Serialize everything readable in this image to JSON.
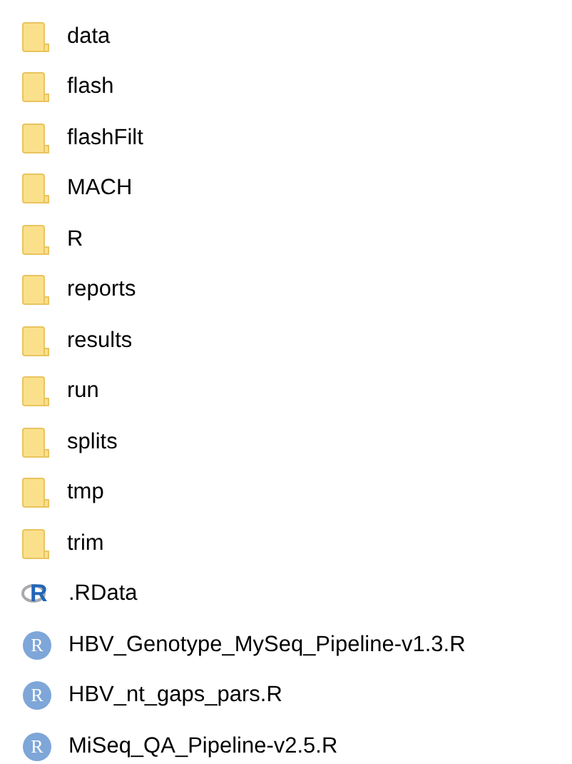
{
  "items": [
    {
      "kind": "folder",
      "name": "data"
    },
    {
      "kind": "folder",
      "name": "flash"
    },
    {
      "kind": "folder",
      "name": "flashFilt"
    },
    {
      "kind": "folder",
      "name": "MACH"
    },
    {
      "kind": "folder",
      "name": "R"
    },
    {
      "kind": "folder",
      "name": "reports"
    },
    {
      "kind": "folder",
      "name": "results"
    },
    {
      "kind": "folder",
      "name": "run"
    },
    {
      "kind": "folder",
      "name": "splits"
    },
    {
      "kind": "folder",
      "name": "tmp"
    },
    {
      "kind": "folder",
      "name": "trim"
    },
    {
      "kind": "rdata",
      "badge": "R",
      "name": ".RData"
    },
    {
      "kind": "rscript",
      "badge": "R",
      "name": "HBV_Genotype_MySeq_Pipeline-v1.3.R"
    },
    {
      "kind": "rscript",
      "badge": "R",
      "name": "HBV_nt_gaps_pars.R"
    },
    {
      "kind": "rscript",
      "badge": "R",
      "name": "MiSeq_QA_Pipeline-v2.5.R"
    }
  ]
}
